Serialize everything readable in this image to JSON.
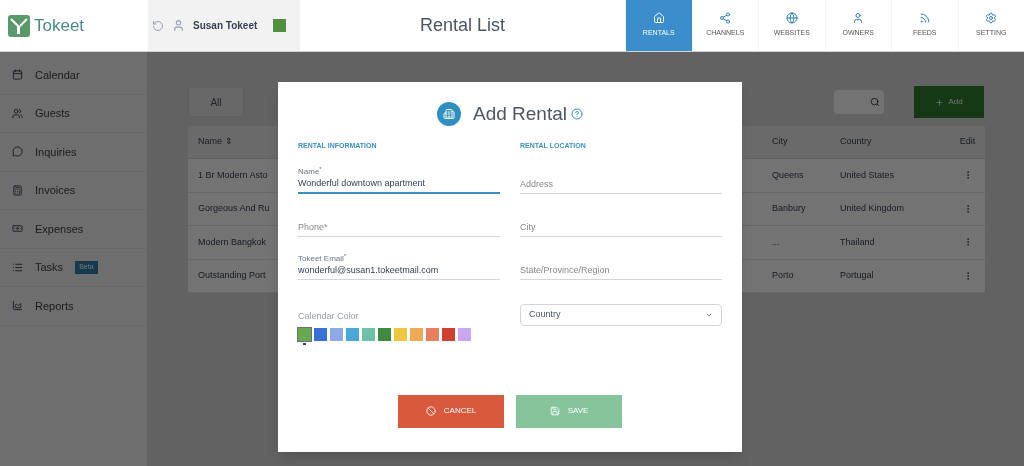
{
  "header": {
    "logo": "Tokeet",
    "user": "Susan Tokeet",
    "title": "Rental List",
    "nav": [
      {
        "label": "RENTALS",
        "selected": true
      },
      {
        "label": "CHANNELS",
        "selected": false
      },
      {
        "label": "WEBSITES",
        "selected": false
      },
      {
        "label": "OWNERS",
        "selected": false
      },
      {
        "label": "FEEDS",
        "selected": false
      },
      {
        "label": "SETTING",
        "selected": false
      }
    ]
  },
  "sidebar": {
    "items": [
      {
        "label": "Calendar"
      },
      {
        "label": "Guests"
      },
      {
        "label": "Inquiries"
      },
      {
        "label": "Invoices"
      },
      {
        "label": "Expenses"
      },
      {
        "label": "Tasks",
        "badge": "Beta"
      },
      {
        "label": "Reports"
      }
    ]
  },
  "filters": [
    {
      "label": "All",
      "selected": true
    }
  ],
  "add_button": "Add",
  "table": {
    "columns": [
      "Name ⇕",
      "City",
      "Country",
      "Edit"
    ],
    "rows": [
      [
        "1 Br Modern Asto",
        "Queens",
        "United States"
      ],
      [
        "Gorgeous And Ru",
        "Banbury",
        "United Kingdom"
      ],
      [
        "Modern Bangkok",
        "...",
        "Thailand"
      ],
      [
        "Outstanding Port",
        "Porto",
        "Portugal"
      ]
    ]
  },
  "dialog": {
    "title": "Add Rental",
    "left_heading": "RENTAL INFORMATION",
    "right_heading": "RENTAL LOCATION",
    "left_fields": [
      {
        "label": "Name$^{*}$",
        "value": "Wonderful downtown apartment",
        "focused": true
      },
      {
        "placeholder": "Phone*",
        "focused": false
      },
      {
        "label": "Tokeet Email$^{*}$",
        "value": "wonderful@susan1.tokeetmail.com",
        "focused": false
      }
    ],
    "right_fields": [
      {
        "placeholder": "Address"
      },
      {
        "placeholder": "City"
      },
      {
        "placeholder": "State/Province/Region"
      }
    ],
    "color_label": "Calendar Color",
    "colors": [
      {
        "color": "#6aa84f",
        "selected": true
      },
      {
        "color": "#3b6fd8",
        "selected": false
      },
      {
        "color": "#8fa8e8",
        "selected": false
      },
      {
        "color": "#4aa8d8",
        "selected": false
      },
      {
        "color": "#6cc1a8",
        "selected": false
      },
      {
        "color": "#3f8a3f",
        "selected": false
      },
      {
        "color": "#f0c640",
        "selected": false
      },
      {
        "color": "#eeaa55",
        "selected": false
      },
      {
        "color": "#e88060",
        "selected": false
      },
      {
        "color": "#d0402e",
        "selected": false
      },
      {
        "color": "#c8a8f0",
        "selected": false
      }
    ],
    "country": "Country",
    "buttons": [
      {
        "label": "CANCEL",
        "kind": "cancel"
      },
      {
        "label": "SAVE",
        "kind": "save"
      }
    ]
  }
}
